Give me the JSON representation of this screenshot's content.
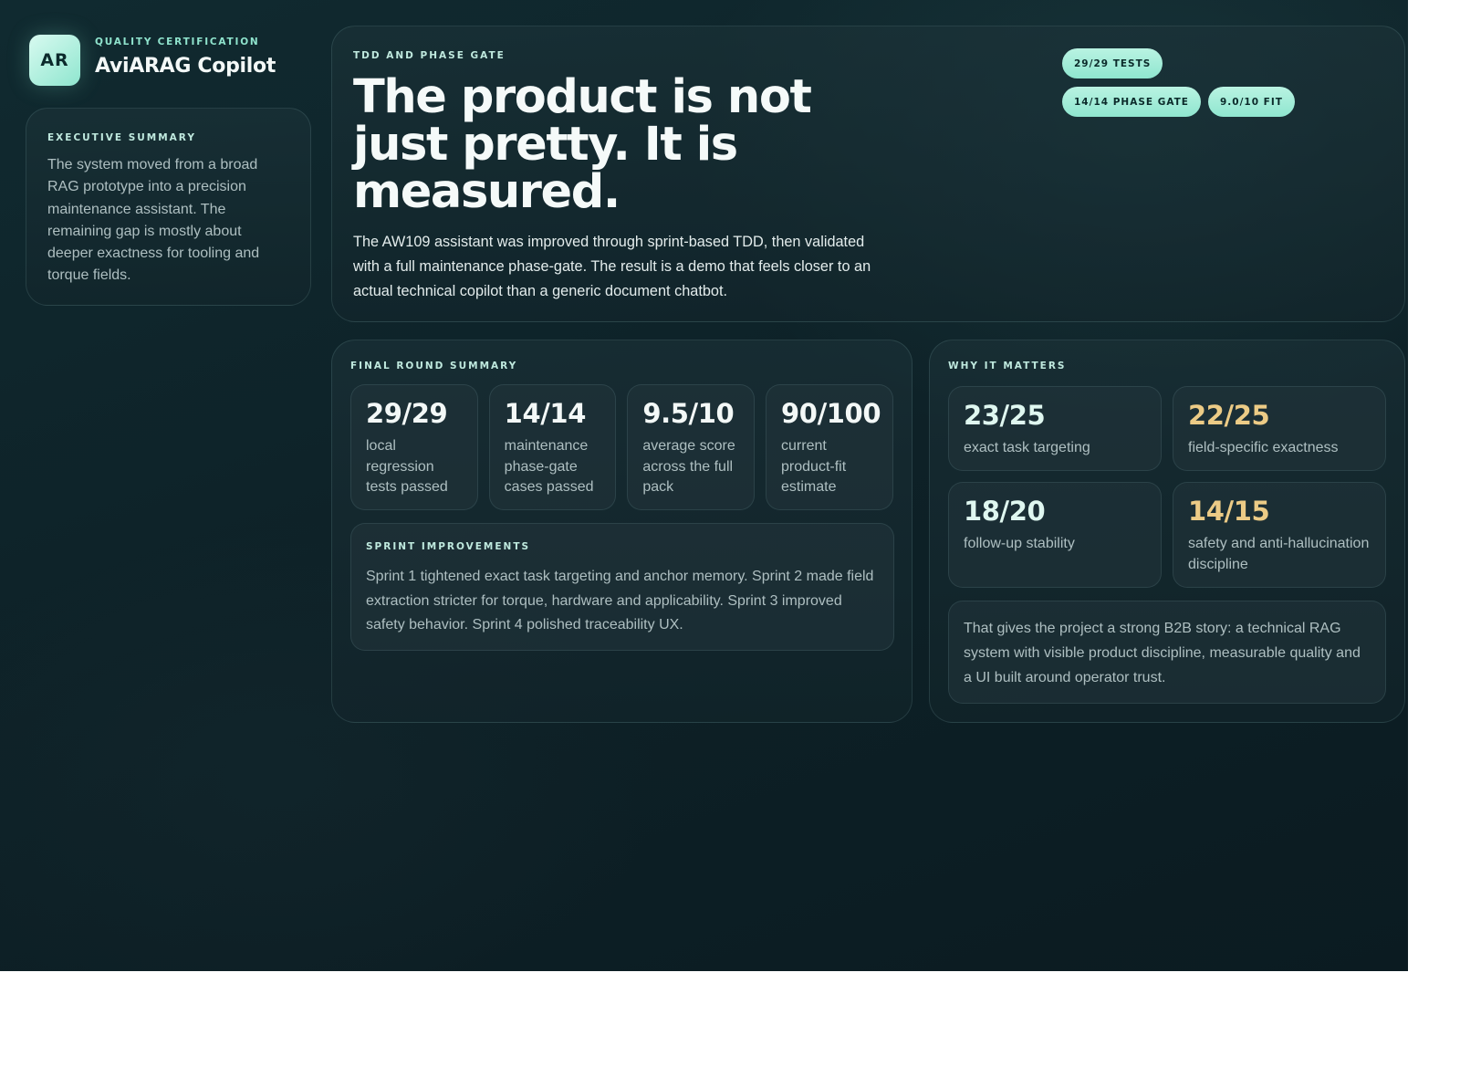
{
  "brand": {
    "logo_text": "AR",
    "kicker": "QUALITY CERTIFICATION",
    "name": "AviARAG Copilot"
  },
  "executive_summary": {
    "kicker": "EXECUTIVE SUMMARY",
    "text": "The system moved from a broad RAG prototype into a precision maintenance assistant. The remaining gap is mostly about deeper exactness for tooling and torque fields."
  },
  "hero": {
    "kicker": "TDD AND PHASE GATE",
    "title": "The product is not just pretty. It is measured.",
    "description": "The AW109 assistant was improved through sprint-based TDD, then validated with a full maintenance phase-gate. The result is a demo that feels closer to an actual technical copilot than a generic document chatbot.",
    "pills": [
      "29/29 TESTS",
      "14/14 PHASE GATE",
      "9.0/10 FIT"
    ]
  },
  "final_round": {
    "kicker": "FINAL ROUND SUMMARY",
    "stats": [
      {
        "value": "29/29",
        "label": "local regression tests passed"
      },
      {
        "value": "14/14",
        "label": "maintenance phase-gate cases passed"
      },
      {
        "value": "9.5/10",
        "label": "average score across the full pack"
      },
      {
        "value": "90/100",
        "label": "current product-fit estimate"
      }
    ],
    "sprint": {
      "kicker": "SPRINT IMPROVEMENTS",
      "text": "Sprint 1 tightened exact task targeting and anchor memory. Sprint 2 made field extraction stricter for torque, hardware and applicability. Sprint 3 improved safety behavior. Sprint 4 polished traceability UX."
    }
  },
  "why_it_matters": {
    "kicker": "WHY IT MATTERS",
    "metrics": [
      {
        "value": "23/25",
        "label": "exact task targeting",
        "accent": "#dff7f0"
      },
      {
        "value": "22/25",
        "label": "field-specific exactness",
        "accent": "#eccb86"
      },
      {
        "value": "18/20",
        "label": "follow-up stability",
        "accent": "#dff7f0"
      },
      {
        "value": "14/15",
        "label": "safety and anti-hallucination discipline",
        "accent": "#eccb86"
      }
    ],
    "note": "That gives the project a strong B2B story: a technical RAG system with visible product discipline, measurable quality and a UI built around operator trust."
  },
  "colors": {
    "background": "#0e2228",
    "accent_mint": "#8fe6cf",
    "accent_gold": "#eccb86"
  }
}
